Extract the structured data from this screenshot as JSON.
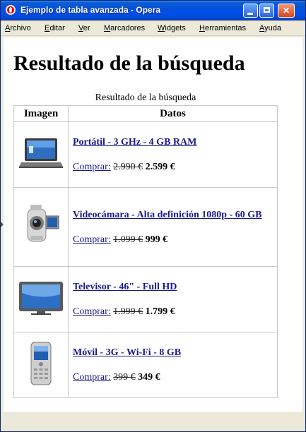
{
  "window": {
    "title": "Ejemplo de tabla avanzada - Opera"
  },
  "menu": {
    "items": [
      {
        "underline": "A",
        "rest": "rchivo"
      },
      {
        "underline": "E",
        "rest": "ditar"
      },
      {
        "underline": "V",
        "rest": "er"
      },
      {
        "underline": "M",
        "rest": "arcadores"
      },
      {
        "underline": "W",
        "rest": "idgets"
      },
      {
        "underline": "H",
        "rest": "erramientas"
      },
      {
        "underline": "A",
        "rest": "yuda"
      }
    ]
  },
  "page": {
    "heading": "Resultado de la búsqueda",
    "table_caption": "Resultado de la búsqueda",
    "headers": {
      "image": "Imagen",
      "data": "Datos"
    },
    "products": [
      {
        "name": "Portátil - 3 GHz - 4 GB RAM",
        "buy": "Comprar:",
        "old_price": "2.990 €",
        "new_price": "2.599 €",
        "icon": "laptop-icon"
      },
      {
        "name": "Videocámara - Alta definición 1080p - 60 GB",
        "buy": "Comprar:",
        "old_price": "1.099 €",
        "new_price": "999 €",
        "icon": "camcorder-icon"
      },
      {
        "name": "Televisor - 46\" - Full HD",
        "buy": "Comprar:",
        "old_price": "1.999 €",
        "new_price": "1.799 €",
        "icon": "tv-icon"
      },
      {
        "name": "Móvil - 3G - Wi-Fi - 8 GB",
        "buy": "Comprar:",
        "old_price": "399 €",
        "new_price": "349 €",
        "icon": "mobile-phone-icon"
      }
    ]
  },
  "colors": {
    "titlebar": "#0450d5",
    "link": "#1a1a8c",
    "chrome": "#ece9d8"
  }
}
